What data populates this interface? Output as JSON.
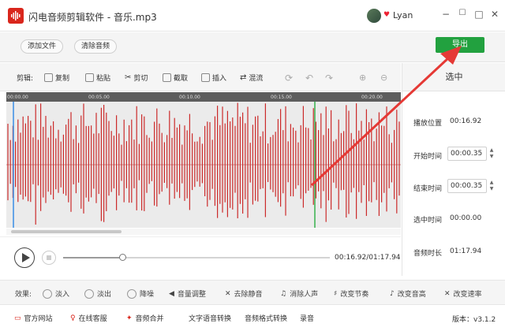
{
  "window": {
    "title": "闪电音频剪辑软件 - 音乐.mp3",
    "username": "Lyan",
    "minimize": "−",
    "restore": "☐",
    "maximize": "□",
    "close": "✕"
  },
  "toolbar": {
    "add_file": "添加文件",
    "clear_audio": "清除音频",
    "export": "导出"
  },
  "edit": {
    "label": "剪辑:",
    "tools": [
      "复制",
      "粘贴",
      "剪切",
      "截取",
      "插入",
      "混流"
    ]
  },
  "timeline": {
    "ticks": [
      "00:00.00",
      "00:05.00",
      "00:10.00",
      "00:15.00",
      "00:20.00"
    ]
  },
  "selection_panel": {
    "header": "选中",
    "play_position_label": "播放位置",
    "play_position": "00:16.92",
    "start_label": "开始时间",
    "start": "00:00.35",
    "end_label": "结束时间",
    "end": "00:00.35",
    "selected_label": "选中时间",
    "selected": "00:00.00",
    "duration_label": "音频时长",
    "duration": "01:17.94"
  },
  "player": {
    "timecode": "00:16.92/01:17.94",
    "progress": 0.217
  },
  "effects": {
    "label": "效果:",
    "items": [
      "淡入",
      "淡出",
      "降噪",
      "音量调整",
      "去除静音",
      "消除人声",
      "改变节奏",
      "改变音高",
      "改变速率"
    ]
  },
  "bottom": {
    "items": [
      "官方网站",
      "在线客服",
      "音频合并",
      "文字语音转换",
      "音频格式转换",
      "录音"
    ],
    "version": "版本：v3.1.2"
  },
  "colors": {
    "accent": "#22a13f",
    "waveform": "#cc2b2b",
    "playhead": "#3a8ee6",
    "cursor": "#37b24d",
    "arrow": "#e53935"
  }
}
